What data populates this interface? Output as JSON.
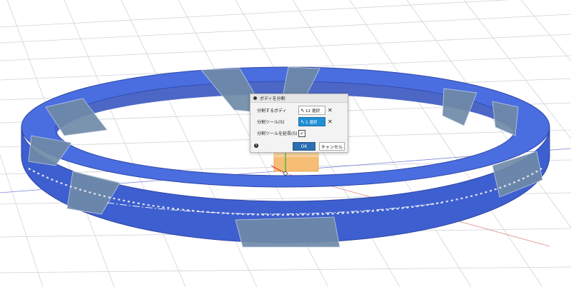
{
  "dialog": {
    "title": "ボディを分割",
    "rows": {
      "bodies": {
        "label": "分割するボディ",
        "selection": "12 選択",
        "arrow_icon": "cursor-arrow-icon"
      },
      "tool": {
        "label": "分割ツール(S)",
        "selection": "1 選択",
        "arrow_icon": "cursor-arrow-icon"
      },
      "extend": {
        "label": "分割ツールを延長(S)",
        "checked": true
      }
    },
    "clear_glyph": "✕",
    "check_glyph": "✓",
    "info_glyph": "i",
    "ok_label": "OK",
    "cancel_label": "キャンセル"
  },
  "colors": {
    "ring_blue": "#3f62d3",
    "ring_dark": "#2c46a9",
    "split_band": "#6f8aa8",
    "grid": "#c9cdd6",
    "tool_box": "#f6be74",
    "accent_button": "#2b6fb3",
    "active_selection": "#1f8fd6"
  }
}
